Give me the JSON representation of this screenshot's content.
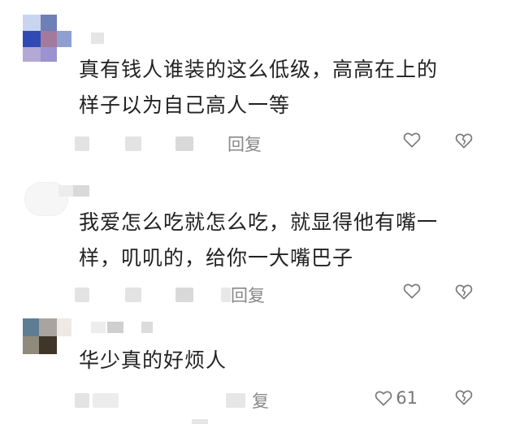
{
  "comments": [
    {
      "text_line1": "真有钱人谁装的这么低级，高高在上的",
      "text_line2": "样子以为自己高人一等",
      "reply_label": "回复",
      "like_count": ""
    },
    {
      "text_line1": "我爱怎么吃就怎么吃，就显得他有嘴一",
      "text_line2": "样，叽叽的，给你一大嘴巴子",
      "reply_label": "回复",
      "like_count": ""
    },
    {
      "text_line1": "华少真的好烦人",
      "text_line2": "",
      "reply_label": "复",
      "like_count": "61"
    }
  ],
  "icons": {
    "like": "heart-outline-icon",
    "dislike": "broken-heart-outline-icon"
  },
  "colors": {
    "text": "#222222",
    "meta": "#888888",
    "icon": "#777777"
  }
}
